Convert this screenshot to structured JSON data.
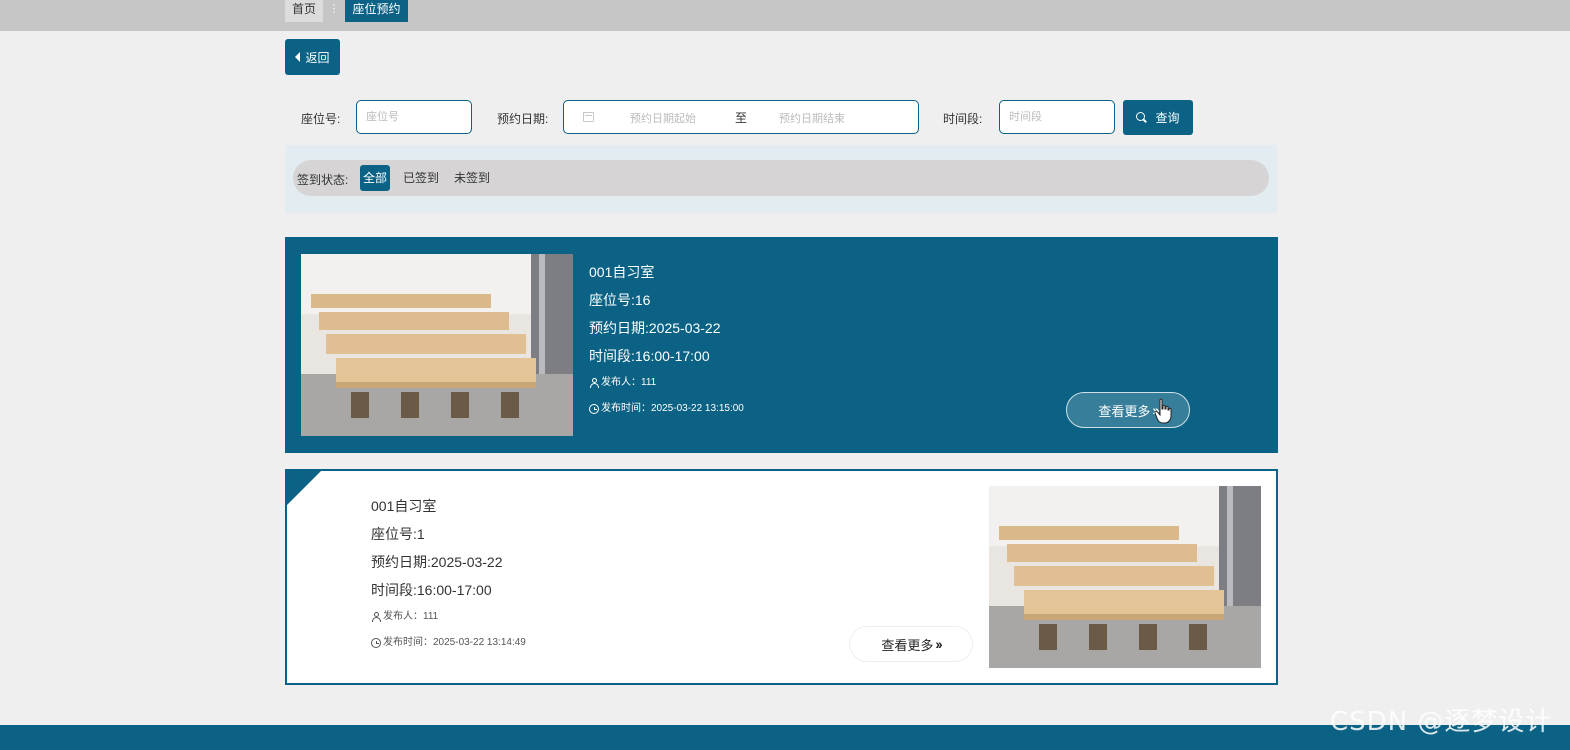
{
  "breadcrumb": {
    "home": "首页",
    "separator": "⋮",
    "current": "座位预约"
  },
  "back_button": {
    "label": "返回",
    "icon": "caret-left-icon"
  },
  "search": {
    "seat_label": "座位号:",
    "seat_placeholder": "座位号",
    "date_label": "预约日期:",
    "date_start_placeholder": "预约日期起始",
    "date_to": "至",
    "date_end_placeholder": "预约日期结束",
    "time_label": "时间段:",
    "time_placeholder": "时间段",
    "query_label": "查询"
  },
  "filter": {
    "label": "签到状态:",
    "options": [
      "全部",
      "已签到",
      "未签到"
    ],
    "selected": "全部"
  },
  "cards": [
    {
      "room": "001自习室",
      "seat": "座位号:16",
      "date": "预约日期:2025-03-22",
      "time": "时间段:16:00-17:00",
      "publisher": "发布人：111",
      "published_at": "发布时间：2025-03-22 13:15:00",
      "more_label": "查看更多"
    },
    {
      "room": "001自习室",
      "seat": "座位号:1",
      "date": "预约日期:2025-03-22",
      "time": "时间段:16:00-17:00",
      "publisher": "发布人：111",
      "published_at": "发布时间：2025-03-22 13:14:49",
      "more_label": "查看更多"
    }
  ],
  "watermark": "CSDN @逐梦设计",
  "colors": {
    "primary": "#0b6284",
    "page_bg": "#efefef",
    "topbar": "#c6c6c6"
  }
}
